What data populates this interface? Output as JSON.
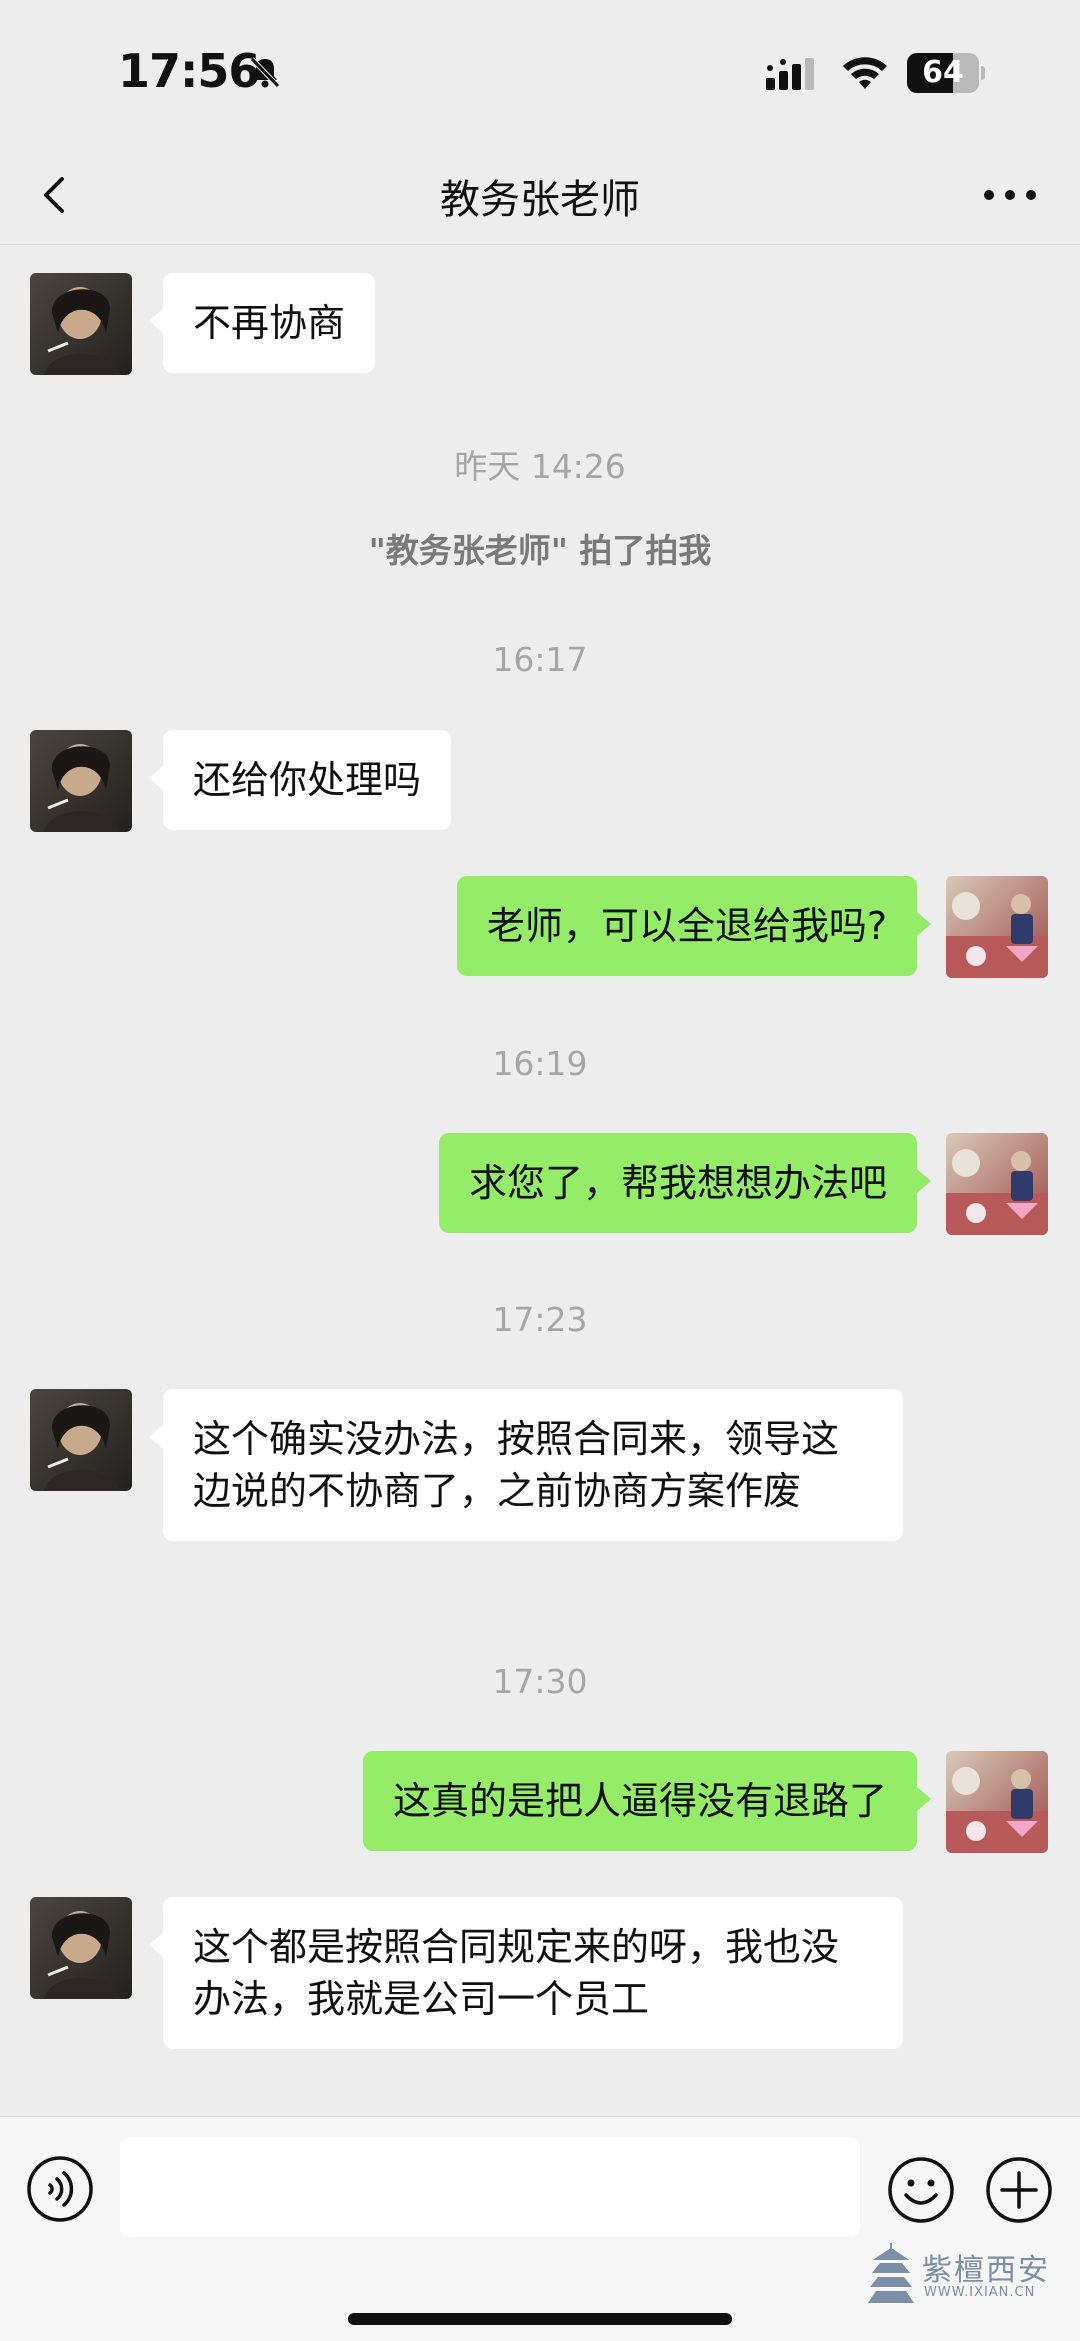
{
  "status_bar": {
    "time": "17:56",
    "battery": "64",
    "battery_level": 0.64
  },
  "nav": {
    "title": "教务张老师"
  },
  "messages": {
    "m1": "不再协商",
    "ts1": "昨天 14:26",
    "sys1": "\"教务张老师\" 拍了拍我",
    "ts2": "16:17",
    "m2": "还给你处理吗",
    "m3": "老师，可以全退给我吗?",
    "ts3": "16:19",
    "m4": "求您了，帮我想想办法吧",
    "ts4": "17:23",
    "m5": "这个确实没办法，按照合同来，领导这边说的不协商了，之前协商方案作废",
    "ts5": "17:30",
    "m6": "这真的是把人逼得没有退路了",
    "m7": "这个都是按照合同规定来的呀，我也没办法，我就是公司一个员工"
  },
  "input": {
    "value": "",
    "placeholder": ""
  },
  "watermark": {
    "main": "紫檀西安",
    "sub": "WWW.IXIAN.CN"
  },
  "colors": {
    "background": "#ededed",
    "incoming_bubble": "#ffffff",
    "outgoing_bubble": "#95ec69"
  },
  "icons": {
    "back": "chevron-left-icon",
    "more": "more-dots-icon",
    "voice": "voice-icon",
    "emoji": "emoji-icon",
    "plus": "plus-icon"
  }
}
